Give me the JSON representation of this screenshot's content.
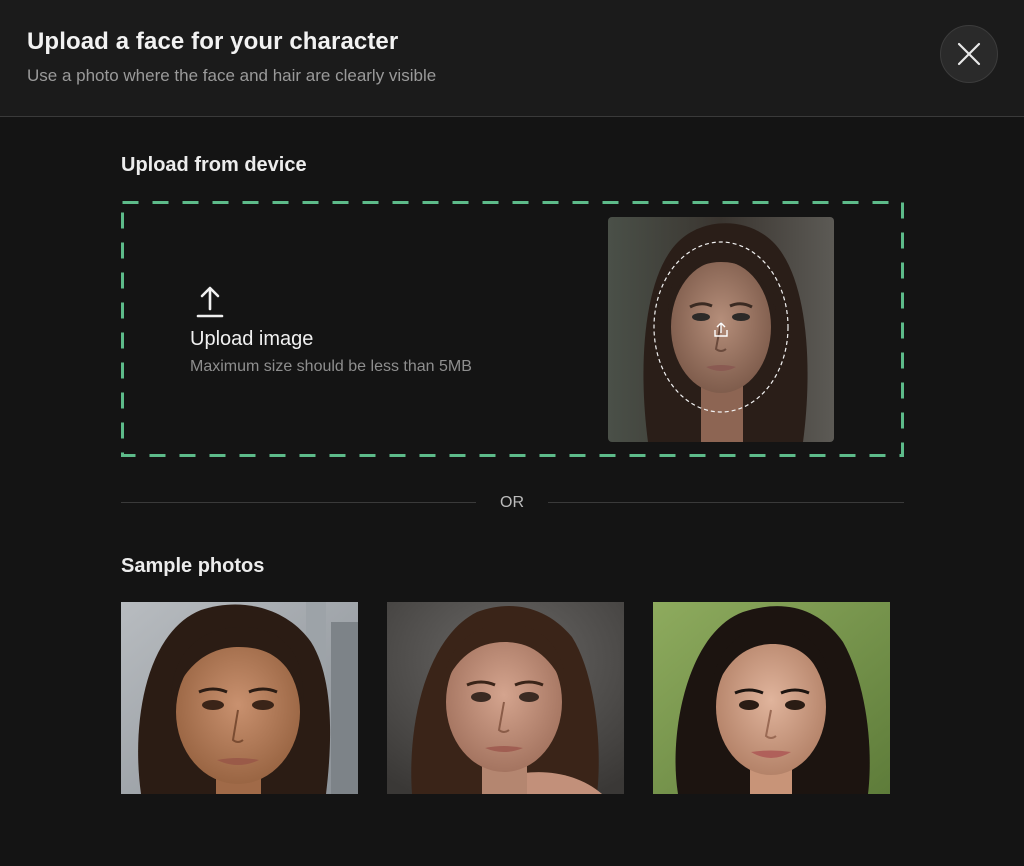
{
  "header": {
    "title": "Upload a face for your character",
    "subtitle": "Use a photo where the face and hair are clearly visible"
  },
  "close_button": {
    "icon": "close-icon"
  },
  "upload_section": {
    "label": "Upload from device",
    "upload_label": "Upload image",
    "hint": "Maximum size should be less than 5MB",
    "icon": "upload-icon",
    "preview_icon": "upload-icon",
    "border_color": "#5dbb8a"
  },
  "divider": {
    "text": "OR"
  },
  "samples_section": {
    "label": "Sample photos",
    "photos": [
      {
        "name": "sample-photo-1"
      },
      {
        "name": "sample-photo-2"
      },
      {
        "name": "sample-photo-3"
      }
    ]
  },
  "colors": {
    "background": "#141414",
    "header_background": "#1b1b1b",
    "accent_dashed_border": "#5dbb8a"
  }
}
